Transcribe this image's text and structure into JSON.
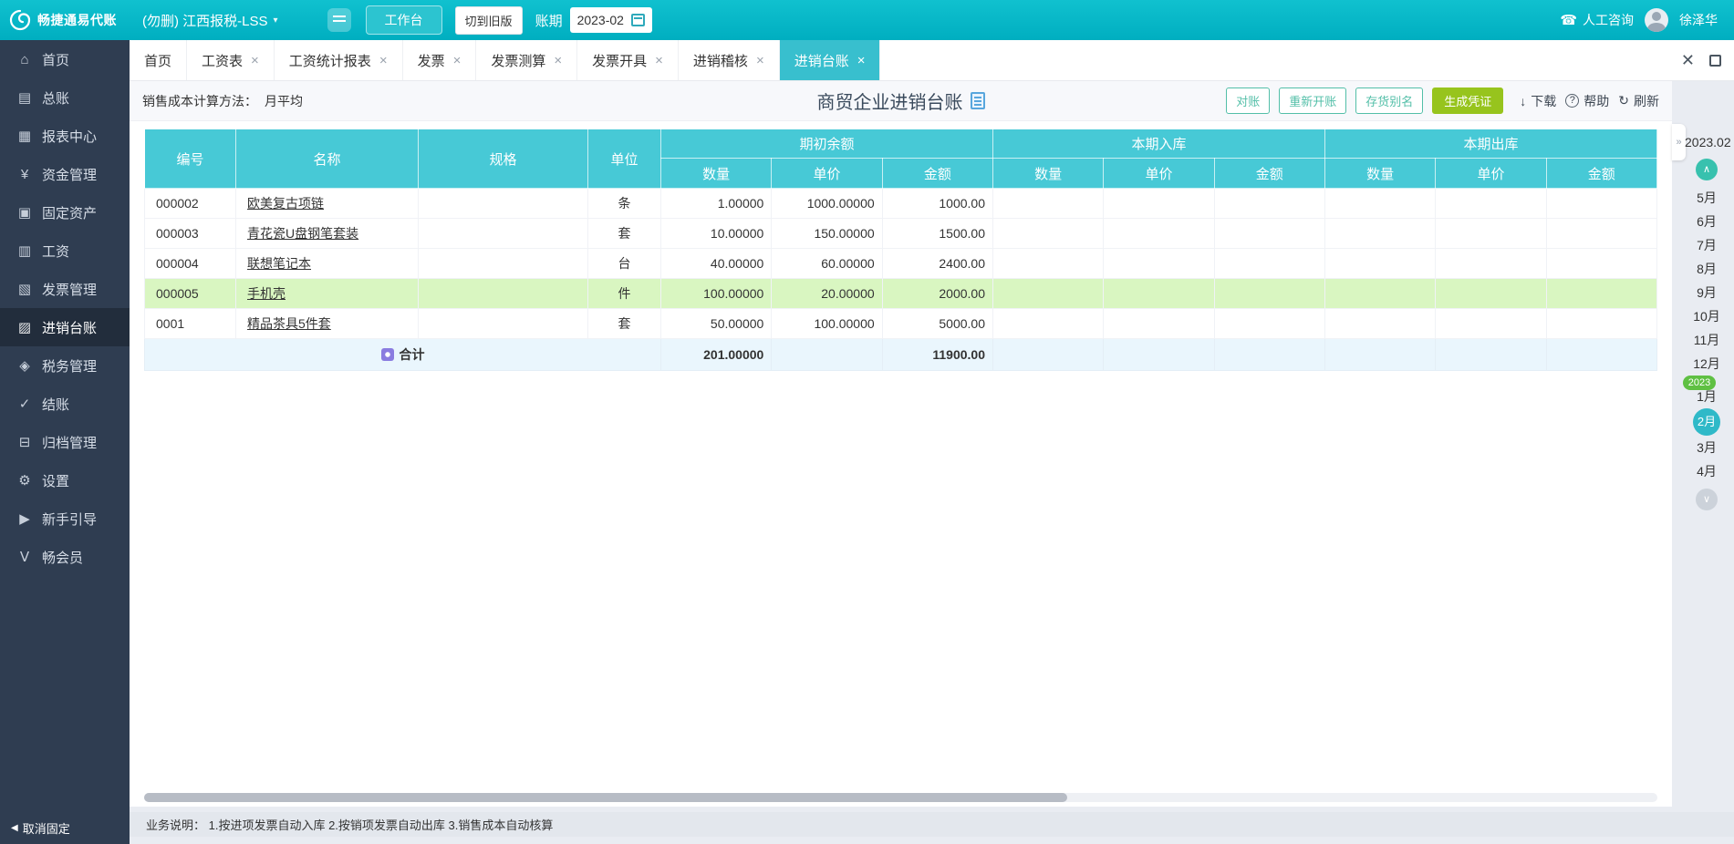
{
  "colors": {
    "header": "#00aec0",
    "header_light": "#10c1cf",
    "workbench": "#2cc4d0",
    "sidebar": "#2f3d51",
    "sidebar_active": "#222d3c",
    "tab_active": "#38bfce",
    "table_header": "#47c9d6",
    "row_highlight": "#d9f6c1",
    "total_row": "#eaf6fd",
    "outline_btn": "#53bfa8",
    "green_btn": "#97c41d",
    "active_month": "#2fb9c8",
    "year_badge": "#5fc043"
  },
  "header": {
    "logo": "畅捷通易代账",
    "company": "(勿删) 江西报税-LSS",
    "workbench": "工作台",
    "switch_old": "切到旧版",
    "period_label": "账期",
    "period_value": "2023-02",
    "consult": "人工咨询",
    "user": "徐泽华"
  },
  "sidebar": {
    "active_index": 7,
    "unpin": "取消固定",
    "items": [
      {
        "label": "首页",
        "icon": "home"
      },
      {
        "label": "总账",
        "icon": "ledger"
      },
      {
        "label": "报表中心",
        "icon": "report"
      },
      {
        "label": "资金管理",
        "icon": "funds"
      },
      {
        "label": "固定资产",
        "icon": "assets"
      },
      {
        "label": "工资",
        "icon": "salary"
      },
      {
        "label": "发票管理",
        "icon": "invoice"
      },
      {
        "label": "进销台账",
        "icon": "inventory"
      },
      {
        "label": "税务管理",
        "icon": "tax"
      },
      {
        "label": "结账",
        "icon": "closing"
      },
      {
        "label": "归档管理",
        "icon": "archive"
      },
      {
        "label": "设置",
        "icon": "settings"
      },
      {
        "label": "新手引导",
        "icon": "guide"
      },
      {
        "label": "畅会员",
        "icon": "member"
      }
    ]
  },
  "tabs": {
    "active_index": 7,
    "items": [
      {
        "label": "首页",
        "closable": false
      },
      {
        "label": "工资表",
        "closable": true
      },
      {
        "label": "工资统计报表",
        "closable": true
      },
      {
        "label": "发票",
        "closable": true
      },
      {
        "label": "发票测算",
        "closable": true
      },
      {
        "label": "发票开具",
        "closable": true
      },
      {
        "label": "进销稽核",
        "closable": true
      },
      {
        "label": "进销台账",
        "closable": true
      }
    ]
  },
  "toolbar": {
    "method_label": "销售成本计算方法：",
    "method_value": "月平均",
    "title": "商贸企业进销台账",
    "btn_reconcile": "对账",
    "btn_reopen": "重新开账",
    "btn_alias": "存货别名",
    "btn_voucher": "生成凭证",
    "download": "下载",
    "help": "帮助",
    "refresh": "刷新"
  },
  "table": {
    "headers": {
      "code": "编号",
      "name": "名称",
      "spec": "规格",
      "unit": "单位",
      "groups": [
        "期初余额",
        "本期入库",
        "本期出库"
      ],
      "subs": [
        "数量",
        "单价",
        "金额"
      ]
    },
    "rows": [
      {
        "code": "000002",
        "name": "欧美复古项链",
        "spec": "",
        "unit": "条",
        "opening_qty": "1.00000",
        "opening_price": "1000.00000",
        "opening_amount": "1000.00",
        "in_qty": "",
        "in_price": "",
        "in_amount": "",
        "out_qty": "",
        "out_price": "",
        "out_amount": "",
        "highlight": false
      },
      {
        "code": "000003",
        "name": "青花瓷U盘钢笔套装",
        "spec": "",
        "unit": "套",
        "opening_qty": "10.00000",
        "opening_price": "150.00000",
        "opening_amount": "1500.00",
        "in_qty": "",
        "in_price": "",
        "in_amount": "",
        "out_qty": "",
        "out_price": "",
        "out_amount": "",
        "highlight": false
      },
      {
        "code": "000004",
        "name": "联想笔记本",
        "spec": "",
        "unit": "台",
        "opening_qty": "40.00000",
        "opening_price": "60.00000",
        "opening_amount": "2400.00",
        "in_qty": "",
        "in_price": "",
        "in_amount": "",
        "out_qty": "",
        "out_price": "",
        "out_amount": "",
        "highlight": false
      },
      {
        "code": "000005",
        "name": "手机壳",
        "spec": "",
        "unit": "件",
        "opening_qty": "100.00000",
        "opening_price": "20.00000",
        "opening_amount": "2000.00",
        "in_qty": "",
        "in_price": "",
        "in_amount": "",
        "out_qty": "",
        "out_price": "",
        "out_amount": "",
        "highlight": true
      },
      {
        "code": "0001",
        "name": "精品茶具5件套",
        "spec": "",
        "unit": "套",
        "opening_qty": "50.00000",
        "opening_price": "100.00000",
        "opening_amount": "5000.00",
        "in_qty": "",
        "in_price": "",
        "in_amount": "",
        "out_qty": "",
        "out_price": "",
        "out_amount": "",
        "highlight": false
      }
    ],
    "total": {
      "label": "合计",
      "qty": "201.00000",
      "amount": "11900.00"
    }
  },
  "month_panel": {
    "period": "2023.02",
    "months_before": [
      "5月",
      "6月",
      "7月",
      "8月",
      "9月",
      "10月",
      "11月",
      "12月"
    ],
    "year_badge": "2023",
    "months_after": [
      "1月",
      "2月",
      "3月",
      "4月"
    ],
    "active_month": "2月"
  },
  "footer": {
    "note": "业务说明：  1.按进项发票自动入库   2.按销项发票自动出库   3.销售成本自动核算"
  }
}
